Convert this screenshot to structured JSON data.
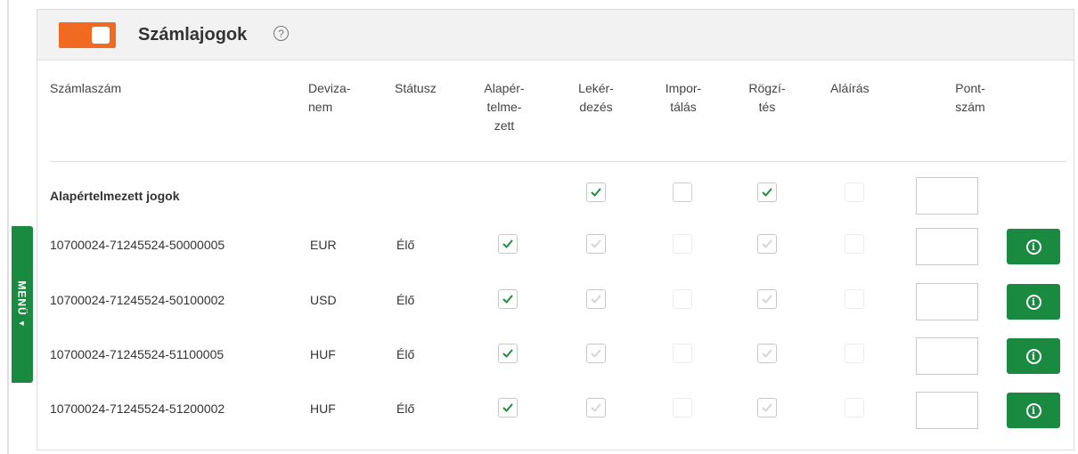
{
  "side_menu": {
    "label": "MENÜ",
    "arrow_icon": "triangle-down-icon"
  },
  "panel": {
    "title": "Számlajogok",
    "help_icon": "question-circle-icon",
    "toggle_color": "#f06b21"
  },
  "columns": {
    "account": "Számlaszám",
    "currency": [
      "Deviza-",
      "nem"
    ],
    "status": "Státusz",
    "default": [
      "Alapér-",
      "telme-",
      "zett"
    ],
    "query": [
      "Lekér-",
      "dezés"
    ],
    "import": [
      "Impor-",
      "tálás"
    ],
    "record": [
      "Rögzí-",
      "tés"
    ],
    "sign": "Aláírás",
    "points": [
      "Pont-",
      "szám"
    ]
  },
  "default_rights": {
    "label": "Alapértelmezett jogok",
    "query": true,
    "import": false,
    "record": true,
    "sign": false,
    "points": ""
  },
  "rows": [
    {
      "account": "10700024-71245524-50000005",
      "currency": "EUR",
      "status": "Élő",
      "default": true,
      "query": true,
      "import": false,
      "record": true,
      "sign": false,
      "points": ""
    },
    {
      "account": "10700024-71245524-50100002",
      "currency": "USD",
      "status": "Élő",
      "default": true,
      "query": true,
      "import": false,
      "record": true,
      "sign": false,
      "points": ""
    },
    {
      "account": "10700024-71245524-51100005",
      "currency": "HUF",
      "status": "Élő",
      "default": true,
      "query": true,
      "import": false,
      "record": true,
      "sign": false,
      "points": ""
    },
    {
      "account": "10700024-71245524-51200002",
      "currency": "HUF",
      "status": "Élő",
      "default": true,
      "query": true,
      "import": false,
      "record": true,
      "sign": false,
      "points": ""
    }
  ],
  "info_icon": "info-circle-icon",
  "accent_color": "#198a3f"
}
